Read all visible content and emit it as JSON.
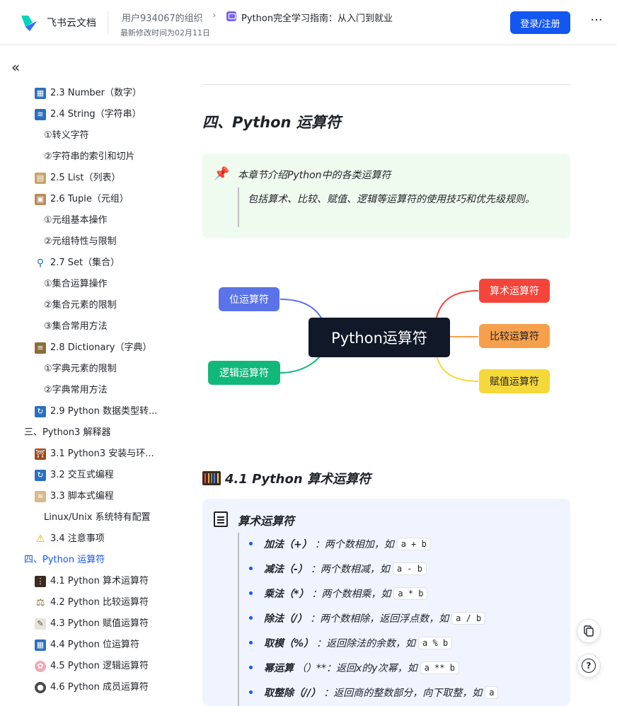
{
  "header": {
    "brand": "飞书云文档",
    "org": "用户934067的组织",
    "separator": "›",
    "doc_title": "Python完全学习指南：从入门到就业",
    "modified": "最新修改时间为02月11日",
    "login_label": "登录/注册",
    "more_label": "···",
    "brand_color": "#1456f0"
  },
  "sidebar": {
    "collapse_label": "«",
    "items": [
      {
        "label": "2.3 Number（数字）",
        "icon": "number-icon"
      },
      {
        "label": "2.4 String（字符串）",
        "icon": "string-icon"
      },
      {
        "label": "①转义字符"
      },
      {
        "label": "②字符串的索引和切片"
      },
      {
        "label": "2.5 List（列表）",
        "icon": "clipboard-icon"
      },
      {
        "label": "2.6 Tuple（元组）",
        "icon": "box-icon"
      },
      {
        "label": "①元组基本操作"
      },
      {
        "label": "②元组特性与限制"
      },
      {
        "label": "2.7 Set（集合）",
        "icon": "magnifier-icon"
      },
      {
        "label": "①集合运算操作"
      },
      {
        "label": "②集合元素的限制"
      },
      {
        "label": "③集合常用方法"
      },
      {
        "label": "2.8 Dictionary（字典）",
        "icon": "books-icon"
      },
      {
        "label": "①字典元素的限制"
      },
      {
        "label": "②字典常用方法"
      },
      {
        "label": "2.9 Python 数据类型转...",
        "icon": "cycle-icon"
      },
      {
        "label": "三、Python3 解释器"
      },
      {
        "label": "3.1 Python3 安装与环...",
        "icon": "shrine-icon"
      },
      {
        "label": "3.2 交互式编程",
        "icon": "cycle-icon"
      },
      {
        "label": "3.3 脚本式编程",
        "icon": "scroll-icon"
      },
      {
        "label": "Linux/Unix 系统特有配置"
      },
      {
        "label": "3.4 注意事项",
        "icon": "warning-icon"
      },
      {
        "label": "四、Python 运算符"
      },
      {
        "label": "4.1 Python 算术运算符",
        "icon": "abacus-icon"
      },
      {
        "label": "4.2 Python 比较运算符",
        "icon": "scales-icon"
      },
      {
        "label": "4.3 Python 赋值运算符",
        "icon": "memo-icon"
      },
      {
        "label": "4.4 Python 位运算符",
        "icon": "number-icon"
      },
      {
        "label": "4.5 Python 逻辑运算符",
        "icon": "brain-icon"
      },
      {
        "label": "4.6 Python 成员运算符",
        "icon": "people-icon"
      }
    ]
  },
  "content": {
    "section_title": "四、Python 运算符",
    "callout": {
      "icon": "pushpin-icon",
      "title": "本章节介绍Python中的各类运算符",
      "desc": "包括算术、比较、赋值、逻辑等运算符的使用技巧和优先级规则。"
    },
    "mindmap": {
      "center": "Python运算符",
      "nodes": {
        "bit": "位运算符",
        "logic": "逻辑运算符",
        "arith": "算术运算符",
        "compare": "比较运算符",
        "assign": "赋值运算符"
      },
      "colors": {
        "bit": "#5b73e8",
        "logic": "#12b87a",
        "arith": "#f5453a",
        "compare": "#f7a04b",
        "assign": "#f5d83a",
        "center": "#111827"
      }
    },
    "sub_title": "4.1 Python 算术运算符",
    "box": {
      "icon": "page-icon",
      "title": "算术运算符",
      "ops": [
        {
          "term": "加法（+）",
          "desc": "：两个数相加，如",
          "code": "a + b"
        },
        {
          "term": "减法（-）",
          "desc": "：两个数相减，如",
          "code": "a - b"
        },
        {
          "term": "乘法（*）",
          "desc": "：两个数相乘，如",
          "code": "a * b"
        },
        {
          "term": "除法（/）",
          "desc": "：两个数相除，返回浮点数，如",
          "code": "a / b"
        },
        {
          "term": "取模（%）",
          "desc": "：返回除法的余数，如",
          "code": "a % b"
        },
        {
          "term": "幂运算",
          "desc": "（）**：返回x的y次幂，如",
          "code": "a ** b"
        },
        {
          "term": "取整除（//）",
          "desc": "：返回商的整数部分，向下取整，如",
          "code": "a"
        }
      ]
    }
  },
  "floating": {
    "copy_icon": "copy-icon",
    "help_label": "?"
  }
}
